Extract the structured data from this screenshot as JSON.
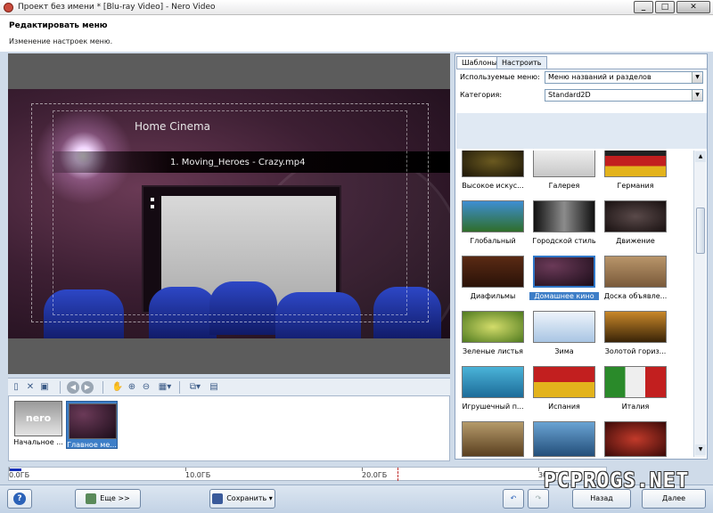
{
  "window": {
    "title": "Проект без имени * [Blu-ray Video] - Nero Video"
  },
  "header": {
    "title": "Редактировать меню",
    "subtitle": "Изменение настроек меню."
  },
  "preview": {
    "menu_title": "Home Cinema",
    "menu_item": "1. Moving_Heroes - Crazy.mp4"
  },
  "pages": [
    {
      "label": "Начальное ..."
    },
    {
      "label": "Главное ме..."
    }
  ],
  "panel": {
    "tabs": [
      "Шаблоны",
      "Настроить"
    ],
    "used_menus_label": "Используемые меню:",
    "used_menus_value": "Меню названий и разделов",
    "category_label": "Категория:",
    "category_value": "Standard2D",
    "templates": [
      "Высокое искус...",
      "Галерея",
      "Германия",
      "Глобальный",
      "Городской стиль",
      "Движение",
      "Диафильмы",
      "Домашнее кино",
      "Доска объявле...",
      "Зеленые листья",
      "Зима",
      "Золотой гориз...",
      "Игрушечный п...",
      "Испания",
      "Италия",
      "",
      "",
      ""
    ]
  },
  "capacity": {
    "labels": [
      "0.0ГБ",
      "10.0ГБ",
      "20.0ГБ",
      "30.0ГБ"
    ],
    "used_fraction": 0.02
  },
  "bottom": {
    "more_label": "Еще >>",
    "save_label": "Сохранить",
    "back_label": "Назад",
    "next_label": "Далее"
  },
  "watermark": "PCPROGS.NET"
}
